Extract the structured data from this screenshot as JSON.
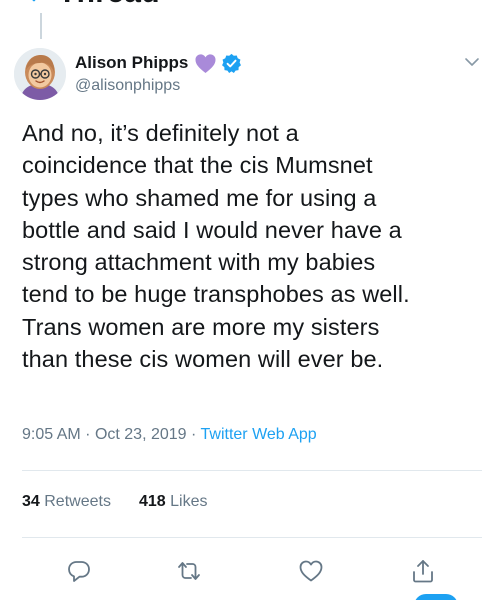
{
  "header": {
    "title": "Thread"
  },
  "tweet": {
    "author": {
      "display_name": "Alison Phipps",
      "handle": "@alisonphipps"
    },
    "text_lines": [
      "And no, it’s definitely not a",
      "coincidence that the cis Mumsnet",
      "types who shamed me for using a",
      "bottle and said I would never have a",
      "strong attachment with my babies",
      "tend to be huge transphobes as well.",
      "Trans women are more my sisters",
      "than these cis women will ever be."
    ],
    "time": "9:05 AM",
    "separator": "·",
    "date": "Oct 23, 2019",
    "source": "Twitter Web App",
    "retweets_count": "34",
    "retweets_label": "Retweets",
    "likes_count": "418",
    "likes_label": "Likes"
  },
  "icons": {
    "back": "chevron-left-icon",
    "heart": "purple-heart-icon",
    "verified": "verified-badge-icon",
    "more": "chevron-down-icon",
    "reply": "reply-icon",
    "retweet": "retweet-icon",
    "like": "like-icon",
    "share": "share-icon"
  },
  "colors": {
    "accent": "#1da1f2",
    "secondary_text": "#657786",
    "primary_text": "#14171a",
    "heart": "#9b6fd6",
    "divider": "#e1e8ed"
  }
}
